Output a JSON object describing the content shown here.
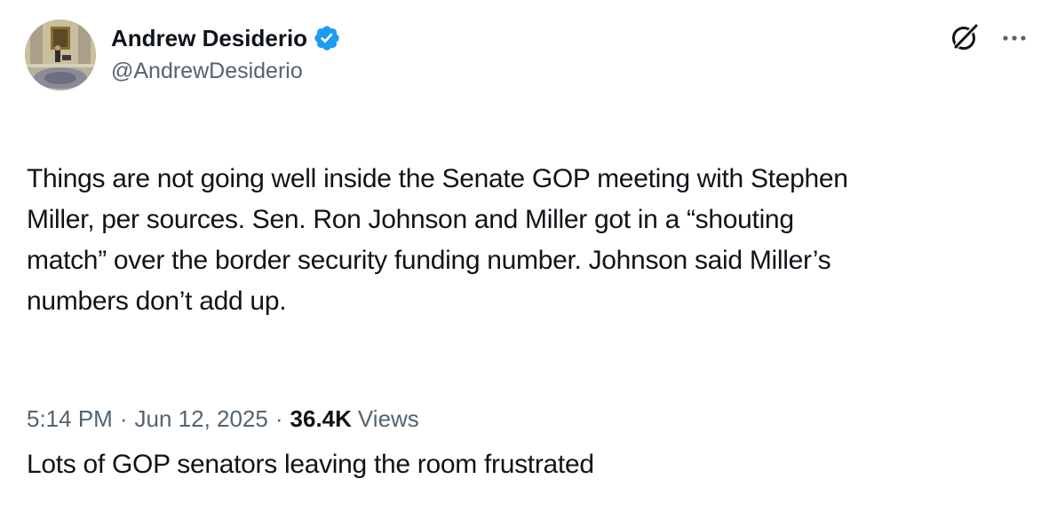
{
  "author": {
    "name": "Andrew Desiderio",
    "handle": "@AndrewDesiderio",
    "verified_color": "#1d9bf0"
  },
  "icons": {
    "verified": "verified-badge-icon",
    "grok": "grok-icon",
    "more": "more-options-icon"
  },
  "tweet": {
    "paragraphs": [
      "Things are not going well inside the Senate GOP meeting with Stephen\nMiller, per sources. Sen. Ron Johnson and Miller got in a “shouting\nmatch” over the border security funding number. Johnson said Miller’s\nnumbers don’t add up.",
      "Lots of GOP senators leaving the room frustrated"
    ]
  },
  "meta": {
    "time": "5:14 PM",
    "separator": "·",
    "date": "Jun 12, 2025",
    "views_count": "36.4K",
    "views_label": "Views"
  }
}
